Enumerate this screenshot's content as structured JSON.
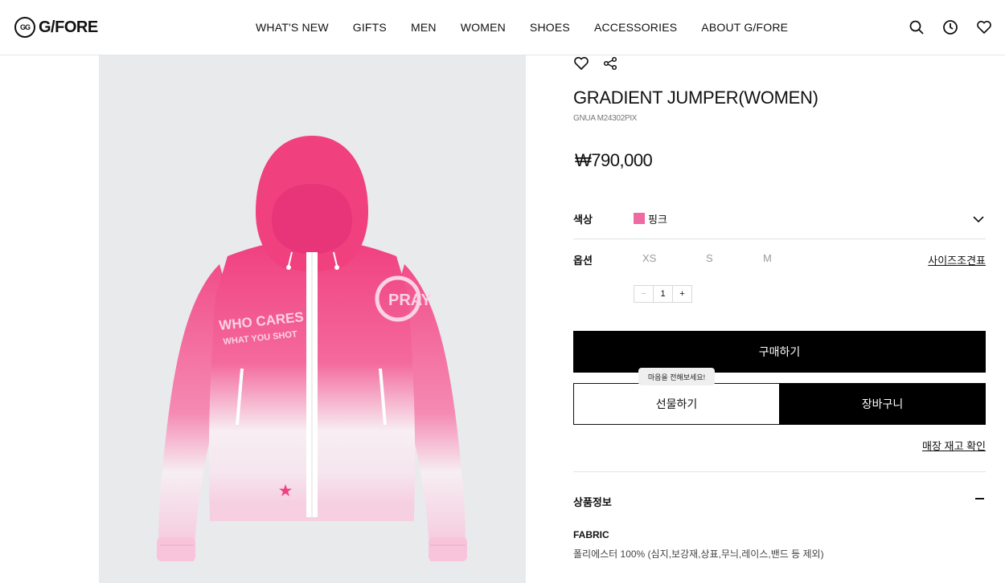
{
  "header": {
    "logo_text": "G/FORE",
    "logo_mark": "GG",
    "nav": [
      "WHAT'S NEW",
      "GIFTS",
      "MEN",
      "WOMEN",
      "SHOES",
      "ACCESSORIES",
      "ABOUT G/FORE"
    ],
    "icons": [
      "search-icon",
      "recent-icon",
      "wishlist-icon"
    ]
  },
  "product": {
    "title": "GRADIENT JUMPER(WOMEN)",
    "code": "GNUA M24302PIX",
    "price": "₩790,000",
    "image": {
      "graphic_text_1": "WHO CARES",
      "graphic_text_2": "WHAT YOU SHOT",
      "graphic_text_3": "PRAY",
      "colors": {
        "pink": "#f0407e",
        "white": "#f5f2f4",
        "background": "#e9eaec"
      }
    }
  },
  "options": {
    "color_label": "색상",
    "color_value": "핑크",
    "color_swatch": "#ef6aa0",
    "size_label": "옵션",
    "sizes": [
      "XS",
      "S",
      "M"
    ],
    "size_chart_link": "사이즈조견표",
    "quantity": "1",
    "qty_minus": "−",
    "qty_plus": "+"
  },
  "actions": {
    "buy": "구매하기",
    "gift_tooltip": "마음을 전해보세요!",
    "gift": "선물하기",
    "cart": "장바구니",
    "store_stock": "매장 재고 확인"
  },
  "details": {
    "section_title": "상품정보",
    "fabric_label": "FABRIC",
    "fabric_value": "폴리에스터 100% (심지,보강재,상표,무늬,레이스,밴드 등 제외)"
  }
}
